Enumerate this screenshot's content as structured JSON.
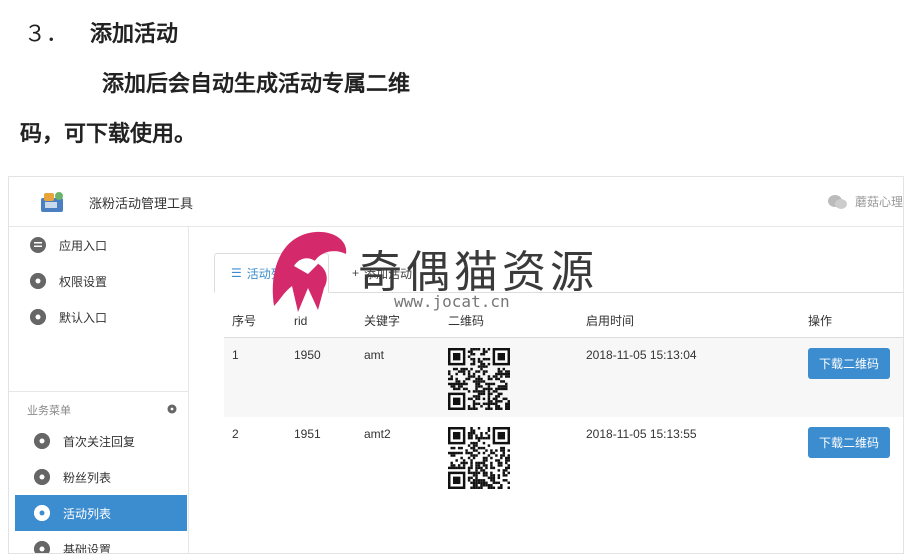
{
  "document": {
    "line1_number": "３．",
    "line1_text": "添加活动",
    "line2": "添加后会自动生成活动专属二维",
    "line3": "码，可下载使用。"
  },
  "app": {
    "title": "涨粉活动管理工具",
    "user_name": "蘑菇心理",
    "accent_color": "#3c8dd0"
  },
  "sidebar": {
    "items": [
      {
        "label": "应用入口",
        "icon": "chat-bubble-icon"
      },
      {
        "label": "权限设置",
        "icon": "gear-icon"
      },
      {
        "label": "默认入口",
        "icon": "gear-icon"
      }
    ],
    "section_title": "业务菜单",
    "business_items": [
      {
        "label": "首次关注回复",
        "icon": "gear-icon"
      },
      {
        "label": "粉丝列表",
        "icon": "gear-icon"
      },
      {
        "label": "活动列表",
        "icon": "gear-icon",
        "active": true
      },
      {
        "label": "基础设置",
        "icon": "gear-icon"
      }
    ]
  },
  "tabs": {
    "active": "活动列表",
    "add": "添加活动"
  },
  "table": {
    "headers": [
      "序号",
      "rid",
      "关键字",
      "二维码",
      "启用时间",
      "操作"
    ],
    "rows": [
      {
        "index": "1",
        "rid": "1950",
        "keyword": "amt",
        "time": "2018-11-05 15:13:04",
        "action": "下载二维码"
      },
      {
        "index": "2",
        "rid": "1951",
        "keyword": "amt2",
        "time": "2018-11-05 15:13:55",
        "action": "下载二维码"
      }
    ]
  },
  "watermark": {
    "text": "奇偶猫资源",
    "url": "www.jocat.cn"
  }
}
